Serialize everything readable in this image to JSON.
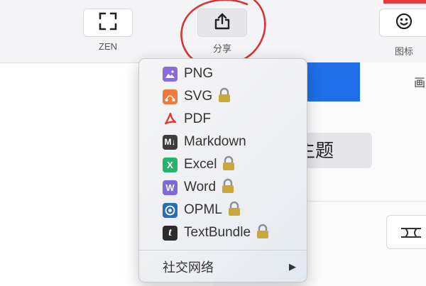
{
  "toolbar": {
    "zen_label": "ZEN",
    "share_label": "分享",
    "icon_label": "图标",
    "zen_icon": "fullscreen-corners-icon",
    "share_icon": "share-upload-icon",
    "icon_icon": "smiley-face-icon"
  },
  "background": {
    "tab_label": "画",
    "theme_label": "主题"
  },
  "share_menu": {
    "items": [
      {
        "label": "PNG",
        "locked": false,
        "icon": "image-icon",
        "color": "#8a6bd8"
      },
      {
        "label": "SVG",
        "locked": true,
        "icon": "svg-icon",
        "color": "#f07a3c"
      },
      {
        "label": "PDF",
        "locked": false,
        "icon": "pdf-icon",
        "color": "#e5322d"
      },
      {
        "label": "Markdown",
        "locked": false,
        "icon": "markdown-icon",
        "color": "#3d3d3d"
      },
      {
        "label": "Excel",
        "locked": true,
        "icon": "excel-icon",
        "color": "#26b36b"
      },
      {
        "label": "Word",
        "locked": true,
        "icon": "word-icon",
        "color": "#7b6ad8"
      },
      {
        "label": "OPML",
        "locked": true,
        "icon": "opml-icon",
        "color": "#2a6db5"
      },
      {
        "label": "TextBundle",
        "locked": true,
        "icon": "textbundle-icon",
        "color": "#2c2c2c"
      }
    ],
    "social_label": "社交网络",
    "social_arrow": "▶",
    "lock_color": "#c8a83c"
  },
  "colors": {
    "annotation_red": "#d93434",
    "accent_blue": "#1e6fe8"
  }
}
